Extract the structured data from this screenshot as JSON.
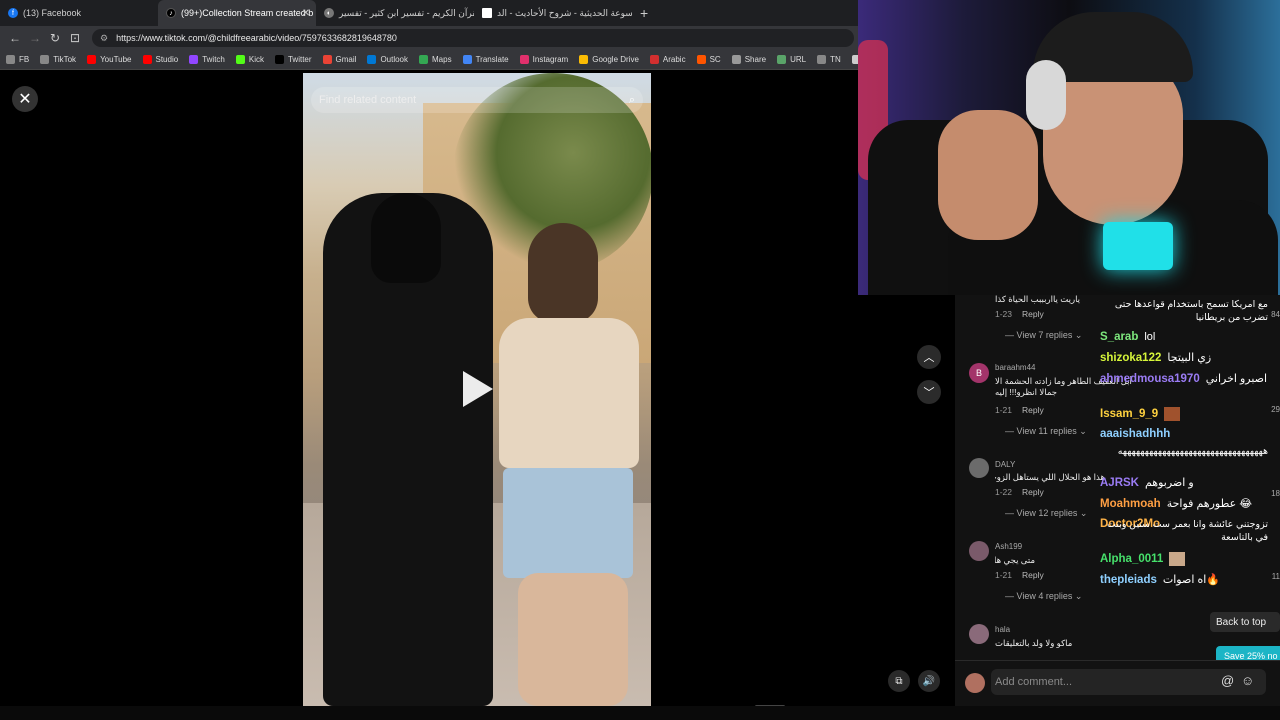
{
  "browser": {
    "tabs": [
      {
        "label": "(13) Facebook",
        "icon": "facebook-icon",
        "color": "#1877f2",
        "active": false
      },
      {
        "label": "(99+)Collection Stream created b",
        "icon": "tiktok-icon",
        "color": "#000000",
        "active": true
      },
      {
        "label": "القرآن الكريم - تفسير ابن كثير - تفسير",
        "icon": "quran-icon",
        "color": "#777777",
        "active": false
      },
      {
        "label": "الموسوعة الحديثية - شروح الأحاديث - الد",
        "icon": "page-icon",
        "color": "#ffffff",
        "active": false
      }
    ],
    "url": "https://www.tiktok.com/@childfreearabic/video/7597633682819648780",
    "bookmarks": [
      {
        "label": "FB",
        "color": "#888888"
      },
      {
        "label": "TikTok",
        "color": "#888888"
      },
      {
        "label": "YouTube",
        "color": "#ff0000"
      },
      {
        "label": "Studio",
        "color": "#ff0000"
      },
      {
        "label": "Twitch",
        "color": "#9146ff"
      },
      {
        "label": "Kick",
        "color": "#53fc18"
      },
      {
        "label": "Twitter",
        "color": "#000000"
      },
      {
        "label": "Gmail",
        "color": "#ea4335"
      },
      {
        "label": "Outlook",
        "color": "#0078d4"
      },
      {
        "label": "Maps",
        "color": "#34a853"
      },
      {
        "label": "Translate",
        "color": "#4285f4"
      },
      {
        "label": "Instagram",
        "color": "#e1306c"
      },
      {
        "label": "Google Drive",
        "color": "#fbbc04"
      },
      {
        "label": "Arabic",
        "color": "#d32f2f"
      },
      {
        "label": "SC",
        "color": "#ff5500"
      },
      {
        "label": "Share",
        "color": "#999999"
      },
      {
        "label": "URL",
        "color": "#5aa469"
      },
      {
        "label": "TN",
        "color": "#888888"
      },
      {
        "label": "Cha",
        "color": "#cccccc"
      }
    ]
  },
  "video": {
    "search_placeholder": "Find related content"
  },
  "comments": [
    {
      "user": "",
      "text": "ياريت يااربببب الحياة كذا",
      "date": "1-23",
      "reply": "Reply",
      "replies": "View 7 replies",
      "likes": "",
      "avatar": ""
    },
    {
      "user": "baraahm44",
      "text": "أبل العقيف الطاهر وما زادته الحشمة الا جمالا انظرو!!! إليه",
      "date": "1-21",
      "reply": "Reply",
      "replies": "View 11 replies",
      "likes": "",
      "avatar": "B"
    },
    {
      "user": "DALY",
      "text": "هذا هو الحلال اللي يستاهل الزوجه وأنا مرتاحه",
      "date": "1-22",
      "reply": "Reply",
      "replies": "View 12 replies",
      "likes": "",
      "avatar": ""
    },
    {
      "user": "Ash199",
      "text": "متى يجي هاليوم",
      "date": "1-21",
      "reply": "Reply",
      "replies": "View 4 replies",
      "likes": "",
      "avatar": ""
    },
    {
      "user": "hala",
      "text": "ماكو ولا ولد بالتعليقات",
      "date": "",
      "reply": "",
      "replies": "",
      "likes": "",
      "avatar": ""
    }
  ],
  "like_counts": [
    "84",
    "29",
    "18",
    "11"
  ],
  "chat": [
    {
      "user": "",
      "text": "مع امريكا تسمح باستخدام قواعدها حتى تضرب من بريطانيا",
      "color": "#ffffff"
    },
    {
      "user": "S_arab",
      "text": "lol",
      "color": "#7ee87e"
    },
    {
      "user": "shizoka122",
      "text": "زي البيتجا",
      "color": "#d6f53a"
    },
    {
      "user": "ahmedmousa1970",
      "text": "اصبرو اخراني",
      "color": "#9b7cf5"
    },
    {
      "user": "Issam_9_9",
      "text": "",
      "color": "#ffd23f"
    },
    {
      "user": "aaaishadhhh",
      "text": "هههههههههههههههههههههههههههههههههه",
      "color": "#8fd0ff"
    },
    {
      "user": "AJRSK",
      "text": "و اضربوهم",
      "color": "#9b7cf5"
    },
    {
      "user": "Moahmoah",
      "text": "عطورهم فواحة 😂",
      "color": "#ff9f43"
    },
    {
      "user": "Doctor2Mo",
      "text": "تزوجتني عائشة وانا بعمر ست سنين وبنت في بالتاسعة",
      "color": "#ffb347"
    },
    {
      "user": "Alpha_0011",
      "text": "",
      "color": "#46e06b"
    },
    {
      "user": "thepleiads",
      "text": "اه اصوات🔥",
      "color": "#8fd0ff"
    }
  ],
  "panel": {
    "back_to_top": "Back to top",
    "promo": "Save 25% no",
    "add_comment_placeholder": "Add comment..."
  }
}
